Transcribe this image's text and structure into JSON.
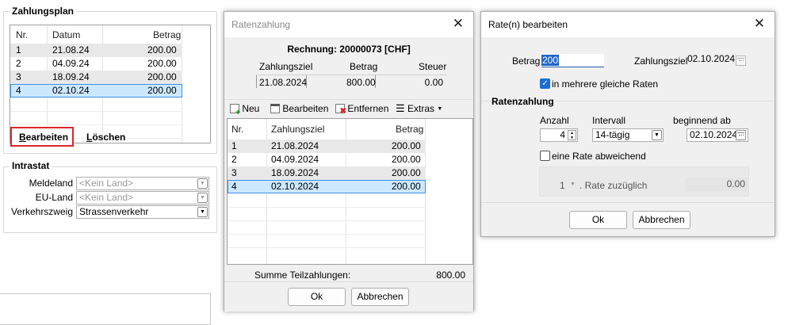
{
  "payment_plan": {
    "title": "Zahlungsplan",
    "columns": [
      "Nr.",
      "Datum",
      "Betrag"
    ],
    "rows": [
      {
        "nr": "1",
        "datum": "21.08.24",
        "betrag": "200.00"
      },
      {
        "nr": "2",
        "datum": "04.09.24",
        "betrag": "200.00"
      },
      {
        "nr": "3",
        "datum": "18.09.24",
        "betrag": "200.00"
      },
      {
        "nr": "4",
        "datum": "02.10.24",
        "betrag": "200.00"
      }
    ],
    "edit_button": "Bearbeiten",
    "edit_button_rest": "earbeiten",
    "edit_button_accel": "B",
    "delete_button": "Löschen",
    "delete_button_accel": "L",
    "delete_button_rest": "öschen"
  },
  "intrastat": {
    "title": "Intrastat",
    "meldeland_label": "Meldeland",
    "meldeland_value": "<Kein Land>",
    "euland_label": "EU-Land",
    "euland_value": "<Kein Land>",
    "verkehrszweig_label": "Verkehrszweig",
    "verkehrszweig_value": "Strassenverkehr"
  },
  "installments_dialog": {
    "title": "Ratenzahlung",
    "invoice_heading": "Rechnung: 20000073 [CHF]",
    "summary_headers": [
      "Zahlungsziel",
      "Betrag",
      "Steuer"
    ],
    "summary_values": [
      "21.08.2024",
      "800.00",
      "0.00"
    ],
    "toolbar": {
      "new": "Neu",
      "edit": "Bearbeiten",
      "remove": "Entfernen",
      "extras": "Extras"
    },
    "columns": [
      "Nr.",
      "Zahlungsziel",
      "Betrag"
    ],
    "rows": [
      {
        "nr": "1",
        "datum": "21.08.2024",
        "betrag": "200.00"
      },
      {
        "nr": "2",
        "datum": "04.09.2024",
        "betrag": "200.00"
      },
      {
        "nr": "3",
        "datum": "18.09.2024",
        "betrag": "200.00"
      },
      {
        "nr": "4",
        "datum": "02.10.2024",
        "betrag": "200.00"
      }
    ],
    "sum_label": "Summe Teilzahlungen:",
    "sum_value": "800.00",
    "ok": "Ok",
    "cancel": "Abbrechen"
  },
  "edit_rate_dialog": {
    "title": "Rate(n) bearbeiten",
    "amount_label": "Betrag",
    "amount_value": "200",
    "due_label": "Zahlungsziel",
    "due_value": "02.10.2024",
    "split_label": "in mehrere gleiche Raten",
    "split_checked": true,
    "group_title": "Ratenzahlung",
    "count_label": "Anzahl",
    "count_value": "4",
    "interval_label": "Intervall",
    "interval_value": "14-tägig",
    "start_label": "beginnend ab",
    "start_value": "02.10.2024",
    "deviating_label": "eine Rate abweichend",
    "deviating_checked": false,
    "deviating_count": "1",
    "deviating_suffix": ". Rate zuzüglich",
    "deviating_amount": "0.00",
    "ok": "Ok",
    "cancel": "Abbrechen"
  },
  "colors": {
    "selection": "#cce8ff",
    "selection_border": "#3d8ee6",
    "alt_row": "#e8e8e8",
    "highlight_frame": "#d9262c",
    "checkbox_blue": "#1a6fd3"
  }
}
